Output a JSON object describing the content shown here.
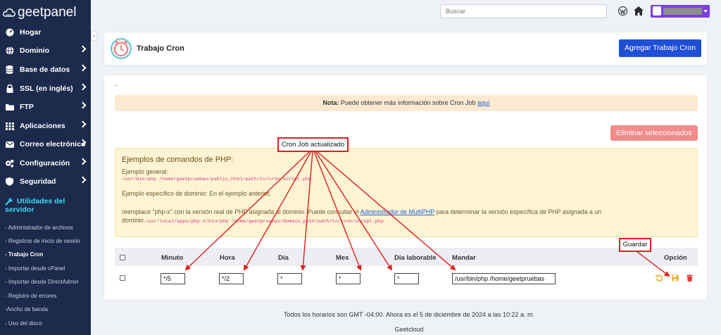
{
  "brand": {
    "name": "geetpanel"
  },
  "sidebar": {
    "items": [
      {
        "label": "Hogar",
        "icon": "gauge-icon"
      },
      {
        "label": "Dominio",
        "icon": "globe-icon"
      },
      {
        "label": "Base de datos",
        "icon": "database-icon"
      },
      {
        "label": "SSL (en inglés)",
        "icon": "lock-icon"
      },
      {
        "label": "FTP",
        "icon": "folder-icon"
      },
      {
        "label": "Aplicaciones",
        "icon": "grid-icon"
      },
      {
        "label": "Correo electrónico",
        "icon": "envelope-icon"
      },
      {
        "label": "Configuración",
        "icon": "gears-icon"
      },
      {
        "label": "Seguridad",
        "icon": "shield-icon"
      }
    ],
    "utilities": {
      "label_line1": "Utilidades del",
      "label_line2": "servidor",
      "icon": "wrench-icon"
    },
    "subitems": [
      "- Administrador de archivos",
      "- Registros de inicio de sesión",
      "- Trabajo Cron",
      "- Importar desde cPanel",
      "- Importar desde DirectAdmin",
      "- Registro de errores",
      "-Ancho de banda",
      "- Uso del disco"
    ],
    "collapse": "‹"
  },
  "topbar": {
    "search_placeholder": "Buscar"
  },
  "header": {
    "title": "Trabajo Cron",
    "add_button": "Agregar Trabajo Cron"
  },
  "main": {
    "dot": "-",
    "note": {
      "bold": "Nota:",
      "text": " Puede obtener más información sobre Cron Job ",
      "link": "aquí"
    },
    "delete_button": "Eliminar seleccionados",
    "examples": {
      "title": "Ejemplos de comandos de PHP:",
      "general_label": "Ejemplo general:",
      "general_code": "/usr/bin/php /home/geetpruebas/public_html/path/to/cron/script.php",
      "specific_label": "Ejemplo específico de dominio: En el ejemplo anterior,",
      "replace_text_1": "reemplace \"php-x\" con la versión real de PHP asignada al dominio. Puede consultar el ",
      "replace_link": "Administrador de MultiPHP",
      "replace_text_2": " para determinar la versión específica de PHP asignada a un",
      "domain_label": "dominio.",
      "domain_code": "/usr/local/apps/php-x/bin/php /home/geetpruebas/domain_path/path/to/cron/script.php"
    },
    "table": {
      "headers": [
        "Minuto",
        "Hora",
        "Día",
        "Mes",
        "Día laborable",
        "Mandar",
        "Opción"
      ],
      "row": {
        "minute": "*/5",
        "hour": "*/2",
        "day": "*",
        "month": "*",
        "weekday": "*",
        "command": "/usr/bin/php /home/geetpruebas"
      }
    }
  },
  "footer": {
    "timezone_text": "Todos los horarios son GMT -04:00. Ahora es el 5 de diciembre de 2024 a las 10:22 a. m.",
    "company": "Geetcloud"
  },
  "annotations": {
    "updated": "Cron Job actualizado",
    "save": "Guardar",
    "color": "#e51c1c"
  }
}
